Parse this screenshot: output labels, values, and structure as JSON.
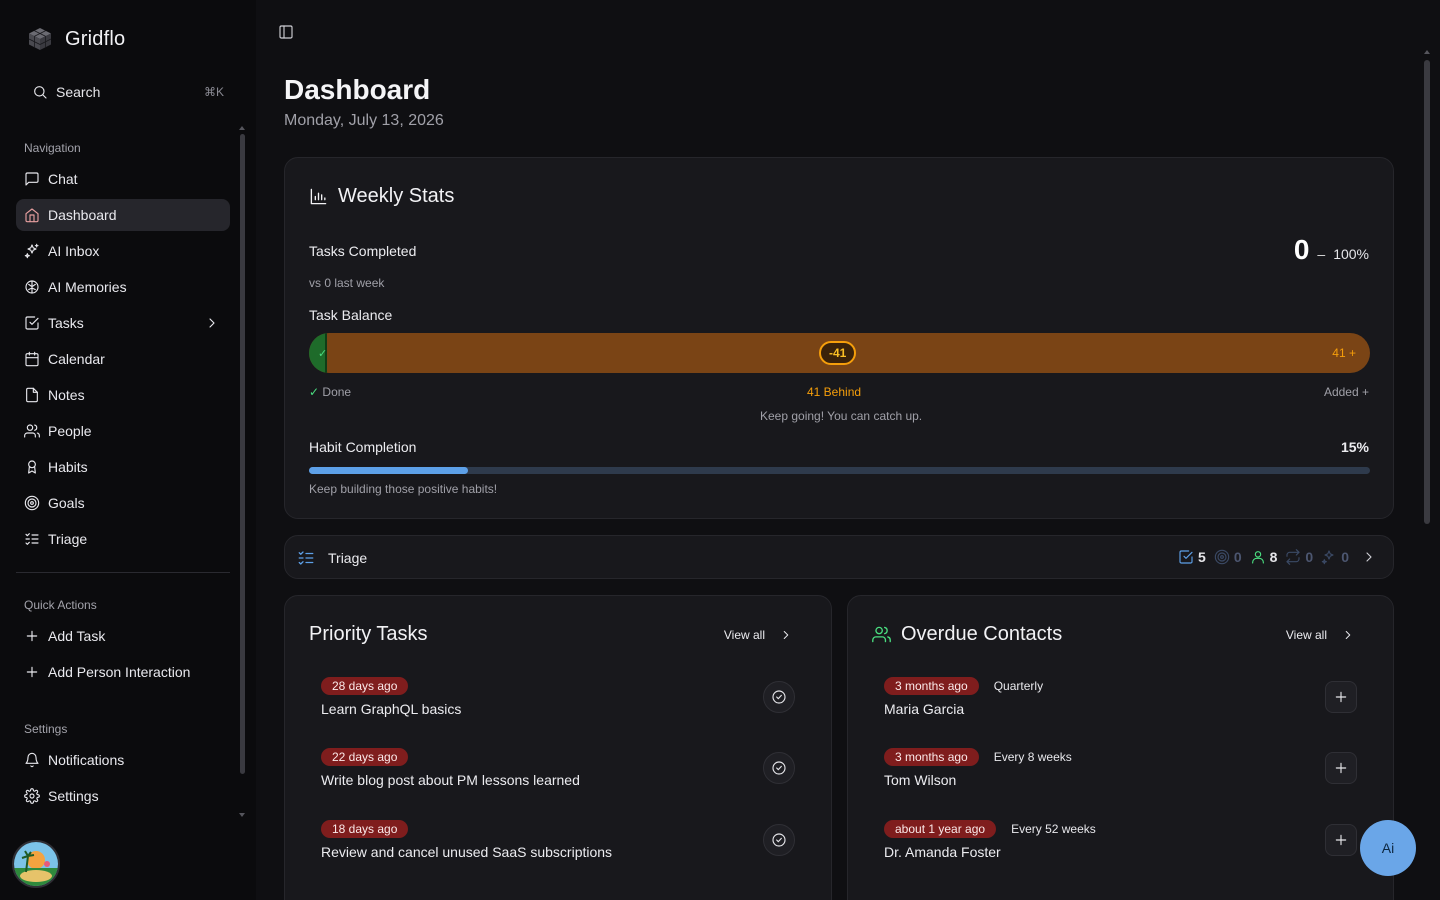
{
  "app": {
    "name": "Gridflo"
  },
  "search": {
    "label": "Search",
    "shortcut": "⌘K"
  },
  "sidebar": {
    "navigation_title": "Navigation",
    "nav": [
      {
        "label": "Chat",
        "icon": "message-square-icon",
        "active": false
      },
      {
        "label": "Dashboard",
        "icon": "home-icon",
        "active": true
      },
      {
        "label": "AI Inbox",
        "icon": "sparkles-icon",
        "active": false
      },
      {
        "label": "AI Memories",
        "icon": "brain-icon",
        "active": false
      },
      {
        "label": "Tasks",
        "icon": "check-square-icon",
        "active": false,
        "has_children": true
      },
      {
        "label": "Calendar",
        "icon": "calendar-icon",
        "active": false
      },
      {
        "label": "Notes",
        "icon": "file-icon",
        "active": false
      },
      {
        "label": "People",
        "icon": "users-icon",
        "active": false
      },
      {
        "label": "Habits",
        "icon": "habit-icon",
        "active": false
      },
      {
        "label": "Goals",
        "icon": "target-icon",
        "active": false
      },
      {
        "label": "Triage",
        "icon": "list-checks-icon",
        "active": false
      }
    ],
    "quick_actions_title": "Quick Actions",
    "quick_actions": [
      {
        "label": "Add Task",
        "icon": "plus-icon"
      },
      {
        "label": "Add Person Interaction",
        "icon": "plus-icon"
      }
    ],
    "settings_title": "Settings",
    "settings": [
      {
        "label": "Notifications",
        "icon": "bell-icon"
      },
      {
        "label": "Settings",
        "icon": "gear-icon"
      }
    ]
  },
  "header": {
    "title": "Dashboard",
    "date": "Monday, July 13, 2026"
  },
  "weekly_stats": {
    "title": "Weekly Stats",
    "tasks_completed_label": "Tasks Completed",
    "tasks_completed_value": "0",
    "tasks_completed_dash": "–",
    "tasks_completed_percent": "100%",
    "vs_last_week": "vs 0 last week",
    "task_balance_label": "Task Balance",
    "balance_pill": "-41",
    "balance_added": "41 +",
    "legend_done": "Done",
    "legend_behind": "41 Behind",
    "legend_added": "Added +",
    "encouragement": "Keep going! You can catch up.",
    "habit_label": "Habit Completion",
    "habit_percent": "15%",
    "habit_fraction": 0.15,
    "habit_note": "Keep building those positive habits!",
    "colors": {
      "behind": "#f59e0b",
      "done": "#4ade80",
      "habit": "#5da0e8"
    }
  },
  "triage": {
    "title": "Triage",
    "stats": [
      {
        "icon": "check-square-icon",
        "value": "5",
        "color": "#5da0e8"
      },
      {
        "icon": "target-icon",
        "value": "0",
        "color": "#3b4a66"
      },
      {
        "icon": "user-icon",
        "value": "8",
        "color": "#4ade80"
      },
      {
        "icon": "repeat-icon",
        "value": "0",
        "color": "#3b4a66"
      },
      {
        "icon": "sparkles-icon",
        "value": "0",
        "color": "#3b4a66"
      }
    ]
  },
  "priority_tasks": {
    "title": "Priority Tasks",
    "view_all": "View all",
    "items": [
      {
        "age": "28 days ago",
        "title": "Learn GraphQL basics"
      },
      {
        "age": "22 days ago",
        "title": "Write blog post about PM lessons learned"
      },
      {
        "age": "18 days ago",
        "title": "Review and cancel unused SaaS subscriptions"
      }
    ]
  },
  "overdue_contacts": {
    "title": "Overdue Contacts",
    "view_all": "View all",
    "items": [
      {
        "age": "3 months ago",
        "frequency": "Quarterly",
        "name": "Maria Garcia"
      },
      {
        "age": "3 months ago",
        "frequency": "Every 8 weeks",
        "name": "Tom Wilson"
      },
      {
        "age": "about 1 year ago",
        "frequency": "Every 52 weeks",
        "name": "Dr. Amanda Foster"
      }
    ]
  },
  "ai_button": {
    "label": "Ai"
  }
}
